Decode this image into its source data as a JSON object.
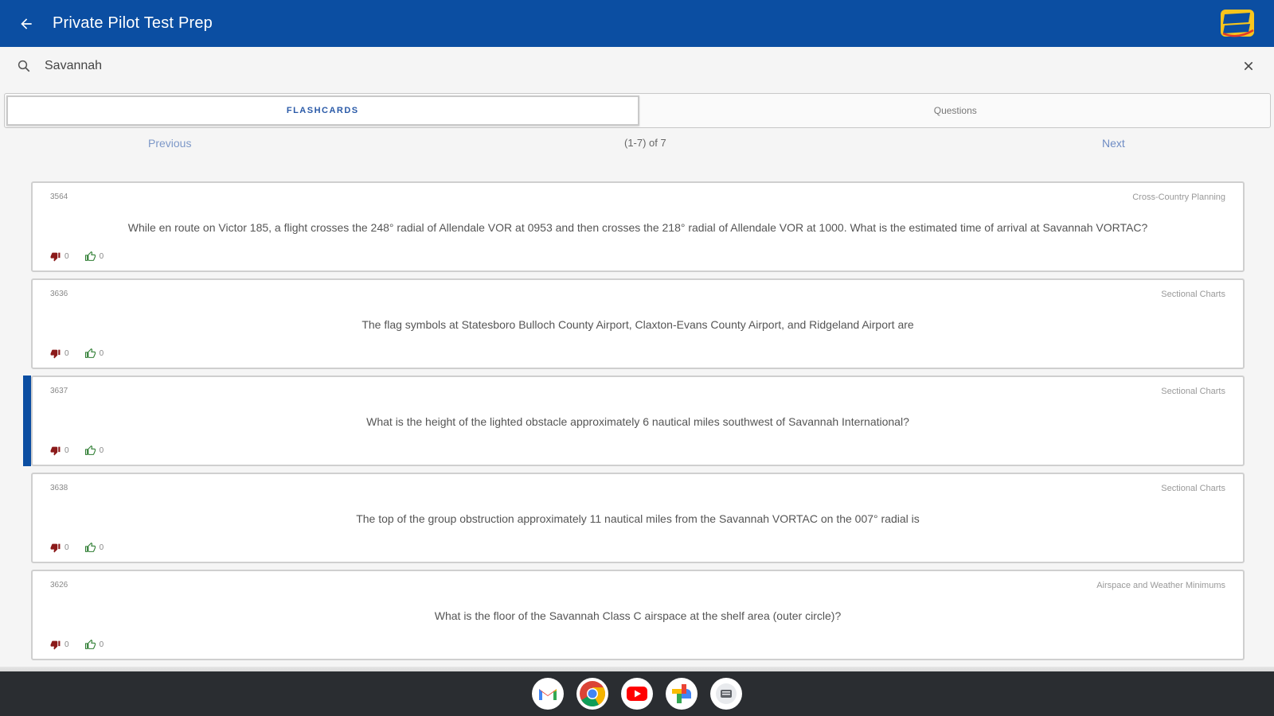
{
  "header": {
    "title": "Private Pilot Test Prep",
    "back_icon": "arrow-left-icon",
    "logo_icon": "king-schools-logo",
    "background": "#0b4ea2"
  },
  "search": {
    "value": "Savannah",
    "placeholder": "Search",
    "icon": "search-icon",
    "clear_icon": "close-icon"
  },
  "tabs": [
    {
      "label": "FLASHCARDS",
      "active": true
    },
    {
      "label": "Questions",
      "active": false
    }
  ],
  "pager": {
    "previous": "Previous",
    "count": "(1-7) of 7",
    "next": "Next"
  },
  "cards": [
    {
      "id": "3564",
      "category": "Cross-Country Planning",
      "question": "While en route on Victor 185, a flight crosses the 248° radial of Allendale VOR at 0953 and then crosses the 218° radial of Allendale VOR at 1000. What is the estimated time of arrival at Savannah VORTAC?",
      "dislikes": "0",
      "likes": "0",
      "selected": false
    },
    {
      "id": "3636",
      "category": "Sectional Charts",
      "question": "The flag symbols at Statesboro Bulloch County Airport, Claxton-Evans County Airport, and Ridgeland Airport are",
      "dislikes": "0",
      "likes": "0",
      "selected": false
    },
    {
      "id": "3637",
      "category": "Sectional Charts",
      "question": "What is the height of the lighted obstacle approximately 6 nautical miles southwest of Savannah International?",
      "dislikes": "0",
      "likes": "0",
      "selected": true
    },
    {
      "id": "3638",
      "category": "Sectional Charts",
      "question": "The top of the group obstruction approximately 11 nautical miles from the Savannah VORTAC on the 007° radial is",
      "dislikes": "0",
      "likes": "0",
      "selected": false
    },
    {
      "id": "3626",
      "category": "Airspace and Weather Minimums",
      "question": "What is the floor of the Savannah Class C airspace at the shelf area (outer circle)?",
      "dislikes": "0",
      "likes": "0",
      "selected": false
    }
  ],
  "dock": {
    "apps": [
      "gmail-icon",
      "chrome-icon",
      "youtube-icon",
      "photos-icon",
      "messages-icon"
    ]
  }
}
